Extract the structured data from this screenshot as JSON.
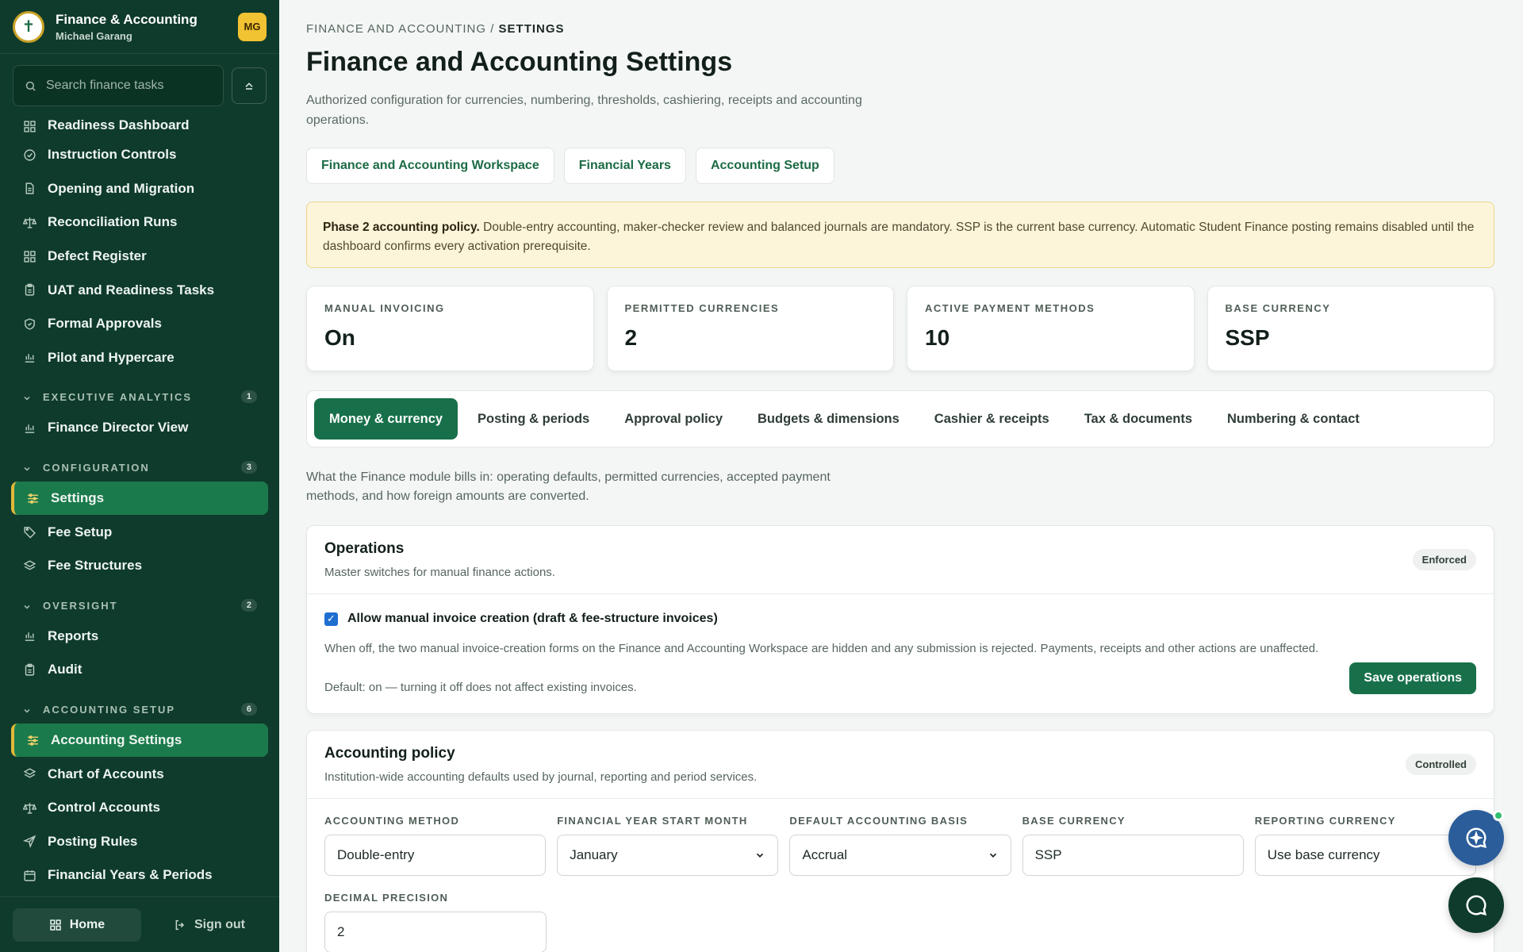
{
  "sidebar": {
    "app_title": "Finance & Accounting",
    "user_name": "Michael Garang",
    "avatar": "MG",
    "logo_glyph": "✝",
    "search_placeholder": "Search finance tasks",
    "items_top": [
      {
        "label": "Readiness Dashboard",
        "icon": "dashboard-icon"
      },
      {
        "label": "Instruction Controls",
        "icon": "check-circle-icon"
      },
      {
        "label": "Opening and Migration",
        "icon": "document-icon"
      },
      {
        "label": "Reconciliation Runs",
        "icon": "scale-icon"
      },
      {
        "label": "Defect Register",
        "icon": "grid-icon"
      },
      {
        "label": "UAT and Readiness Tasks",
        "icon": "clipboard-icon"
      },
      {
        "label": "Formal Approvals",
        "icon": "shield-check-icon"
      },
      {
        "label": "Pilot and Hypercare",
        "icon": "bar-chart-icon"
      }
    ],
    "sections": [
      {
        "title": "EXECUTIVE ANALYTICS",
        "count": "1",
        "items": [
          {
            "label": "Finance Director View",
            "icon": "bar-chart-icon"
          }
        ]
      },
      {
        "title": "CONFIGURATION",
        "count": "3",
        "items": [
          {
            "label": "Settings",
            "icon": "sliders-icon",
            "active": true
          },
          {
            "label": "Fee Setup",
            "icon": "tag-icon"
          },
          {
            "label": "Fee Structures",
            "icon": "layers-icon"
          }
        ]
      },
      {
        "title": "OVERSIGHT",
        "count": "2",
        "items": [
          {
            "label": "Reports",
            "icon": "bar-chart-icon"
          },
          {
            "label": "Audit",
            "icon": "clipboard-icon"
          }
        ]
      },
      {
        "title": "ACCOUNTING SETUP",
        "count": "6",
        "items": [
          {
            "label": "Accounting Settings",
            "icon": "sliders-icon",
            "active": true
          },
          {
            "label": "Chart of Accounts",
            "icon": "layers-icon"
          },
          {
            "label": "Control Accounts",
            "icon": "scale-icon"
          },
          {
            "label": "Posting Rules",
            "icon": "send-icon"
          },
          {
            "label": "Financial Years & Periods",
            "icon": "calendar-icon"
          }
        ]
      }
    ],
    "footer": {
      "home": "Home",
      "sign_out": "Sign out"
    }
  },
  "main": {
    "breadcrumb_parent": "FINANCE AND ACCOUNTING",
    "breadcrumb_sep": " / ",
    "breadcrumb_current": "SETTINGS",
    "title": "Finance and Accounting Settings",
    "subtitle": "Authorized configuration for currencies, numbering, thresholds, cashiering, receipts and accounting operations.",
    "links": [
      "Finance and Accounting Workspace",
      "Financial Years",
      "Accounting Setup"
    ],
    "notice_bold": "Phase 2 accounting policy.",
    "notice_text": " Double-entry accounting, maker-checker review and balanced journals are mandatory. SSP is the current base currency. Automatic Student Finance posting remains disabled until the dashboard confirms every activation prerequisite.",
    "stats": [
      {
        "label": "MANUAL INVOICING",
        "value": "On"
      },
      {
        "label": "PERMITTED CURRENCIES",
        "value": "2"
      },
      {
        "label": "ACTIVE PAYMENT METHODS",
        "value": "10"
      },
      {
        "label": "BASE CURRENCY",
        "value": "SSP"
      }
    ],
    "tabs": [
      "Money & currency",
      "Posting & periods",
      "Approval policy",
      "Budgets & dimensions",
      "Cashier & receipts",
      "Tax & documents",
      "Numbering & contact"
    ],
    "active_tab": 0,
    "tab_description": "What the Finance module bills in: operating defaults, permitted currencies, accepted payment methods, and how foreign amounts are converted.",
    "operations": {
      "title": "Operations",
      "subtitle": "Master switches for manual finance actions.",
      "badge": "Enforced",
      "checkbox_label": "Allow manual invoice creation (draft & fee-structure invoices)",
      "help": "When off, the two manual invoice-creation forms on the Finance and Accounting Workspace are hidden and any submission is rejected. Payments, receipts and other actions are unaffected.",
      "default": "Default: on — turning it off does not affect existing invoices.",
      "save": "Save operations"
    },
    "accounting_policy": {
      "title": "Accounting policy",
      "subtitle": "Institution-wide accounting defaults used by journal, reporting and period services.",
      "badge": "Controlled",
      "fields": [
        {
          "label": "ACCOUNTING METHOD",
          "value": "Double-entry",
          "select": false
        },
        {
          "label": "FINANCIAL YEAR START MONTH",
          "value": "January",
          "select": true
        },
        {
          "label": "DEFAULT ACCOUNTING BASIS",
          "value": "Accrual",
          "select": true
        },
        {
          "label": "BASE CURRENCY",
          "value": "SSP",
          "select": false
        },
        {
          "label": "REPORTING CURRENCY",
          "value": "Use base currency",
          "select": true
        }
      ],
      "decimal_label": "DECIMAL PRECISION",
      "decimal_value": "2"
    }
  }
}
